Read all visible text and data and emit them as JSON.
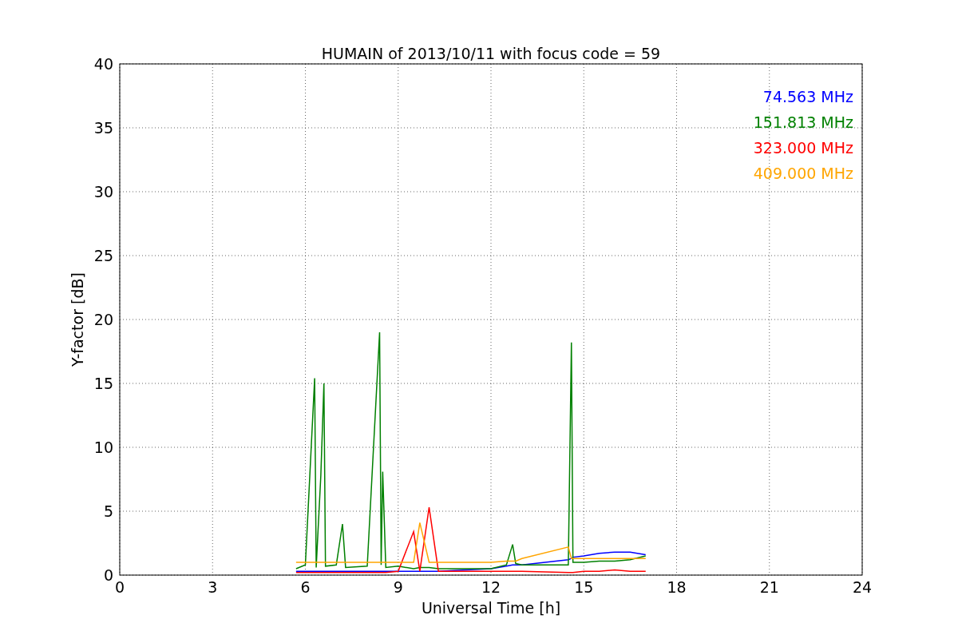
{
  "figure": {
    "chart_data": {
      "type": "line",
      "title": "HUMAIN of 2013/10/11 with focus code = 59",
      "xlabel": "Universal Time [h]",
      "ylabel": "Y-factor [dB]",
      "x": [
        5.7,
        6.0,
        6.3,
        6.35,
        6.5,
        6.6,
        6.65,
        7.0,
        7.2,
        7.3,
        8.0,
        8.4,
        8.45,
        8.5,
        8.6,
        9.0,
        9.5,
        9.7,
        10.0,
        10.3,
        12.0,
        12.5,
        12.7,
        12.8,
        13.0,
        14.5,
        14.6,
        14.65,
        15.0,
        15.5,
        16.0,
        16.5,
        17.0
      ],
      "series": [
        {
          "name": "74.563 MHz",
          "color": "#0000ff",
          "values": [
            0.3,
            0.3,
            0.3,
            0.3,
            0.3,
            0.3,
            0.3,
            0.3,
            0.3,
            0.3,
            0.3,
            0.3,
            0.3,
            0.3,
            0.3,
            0.3,
            0.3,
            0.3,
            0.3,
            0.3,
            0.5,
            0.7,
            0.8,
            0.8,
            0.8,
            1.2,
            1.3,
            1.4,
            1.5,
            1.7,
            1.8,
            1.8,
            1.6
          ]
        },
        {
          "name": "151.813 MHz",
          "color": "#008000",
          "values": [
            0.5,
            0.8,
            15.4,
            0.6,
            7.8,
            15.0,
            0.7,
            0.8,
            4.0,
            0.6,
            0.7,
            19.0,
            0.8,
            8.1,
            0.6,
            0.7,
            0.5,
            0.6,
            0.6,
            0.5,
            0.5,
            0.8,
            2.4,
            0.9,
            0.8,
            0.8,
            18.2,
            1.0,
            1.0,
            1.1,
            1.1,
            1.2,
            1.5
          ]
        },
        {
          "name": "323.000 MHz",
          "color": "#ff0000",
          "values": [
            0.2,
            0.2,
            0.2,
            0.2,
            0.2,
            0.2,
            0.2,
            0.2,
            0.2,
            0.2,
            0.2,
            0.2,
            0.2,
            0.2,
            0.2,
            0.3,
            3.4,
            0.3,
            5.3,
            0.3,
            0.3,
            0.3,
            0.3,
            0.3,
            0.3,
            0.2,
            0.2,
            0.2,
            0.3,
            0.3,
            0.4,
            0.3,
            0.3
          ]
        },
        {
          "name": "409.000 MHz",
          "color": "#ffa500",
          "values": [
            1.0,
            1.0,
            1.0,
            1.0,
            1.0,
            1.0,
            1.0,
            1.0,
            1.0,
            1.0,
            1.0,
            1.0,
            1.0,
            1.0,
            1.0,
            1.0,
            1.0,
            4.1,
            1.0,
            1.0,
            1.0,
            1.1,
            1.1,
            1.1,
            1.3,
            2.2,
            1.3,
            1.3,
            1.3,
            1.3,
            1.3,
            1.3,
            1.3
          ]
        }
      ],
      "grid": true,
      "xlim": [
        0,
        24
      ],
      "ylim": [
        0,
        40
      ],
      "xticks": [
        0,
        3,
        6,
        9,
        12,
        15,
        18,
        21,
        24
      ],
      "yticks": [
        0,
        5,
        10,
        15,
        20,
        25,
        30,
        35,
        40
      ]
    }
  }
}
